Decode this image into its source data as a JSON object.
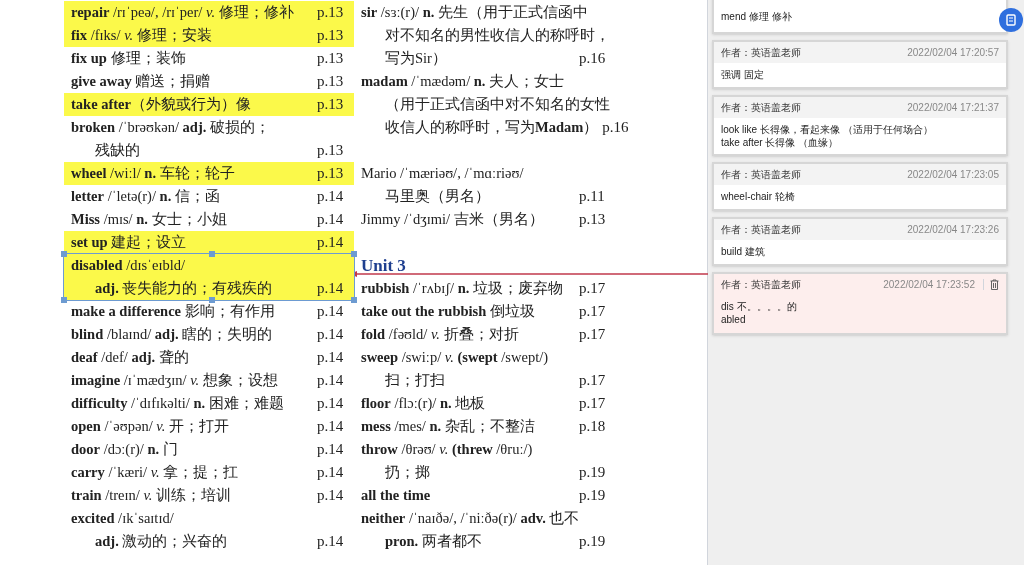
{
  "document": {
    "columns": [
      {
        "sections": [
          {
            "entries": [
              {
                "highlighted": true,
                "selected": false,
                "lines": [
                  {
                    "text": "**repair** /rɪˈpeə/, /rɪˈper/ *v.* 修理；修补",
                    "page": "p.13"
                  }
                ]
              },
              {
                "highlighted": true,
                "selected": false,
                "lines": [
                  {
                    "text": "**fix** /fɪks/ *v.* 修理；安装",
                    "page": "p.13"
                  }
                ]
              },
              {
                "highlighted": false,
                "selected": false,
                "lines": [
                  {
                    "text": "**fix up** 修理；装饰",
                    "page": "p.13"
                  }
                ]
              },
              {
                "highlighted": false,
                "selected": false,
                "lines": [
                  {
                    "text": "**give away** 赠送；捐赠",
                    "page": "p.13"
                  }
                ]
              },
              {
                "highlighted": true,
                "selected": false,
                "lines": [
                  {
                    "text": "**take after**（外貌或行为）像",
                    "page": "p.13"
                  }
                ]
              },
              {
                "highlighted": false,
                "selected": false,
                "lines": [
                  {
                    "text": "**broken** /ˈbrəʊkən/ **adj.** 破损的；"
                  },
                  {
                    "text": "残缺的",
                    "page": "p.13"
                  }
                ]
              },
              {
                "highlighted": true,
                "selected": false,
                "lines": [
                  {
                    "text": "**wheel** /wiːl/ **n.** 车轮；轮子",
                    "page": "p.13"
                  }
                ]
              },
              {
                "highlighted": false,
                "selected": false,
                "lines": [
                  {
                    "text": "**letter** /ˈletə(r)/ **n.** 信；函",
                    "page": "p.14"
                  }
                ]
              },
              {
                "highlighted": false,
                "selected": false,
                "lines": [
                  {
                    "text": "**Miss** /mɪs/ **n.** 女士；小姐",
                    "page": "p.14"
                  }
                ]
              },
              {
                "highlighted": true,
                "selected": false,
                "lines": [
                  {
                    "text": "**set up** 建起；设立",
                    "page": "p.14"
                  }
                ]
              },
              {
                "highlighted": true,
                "selected": true,
                "lines": [
                  {
                    "text": "**disabled** /dɪsˈeɪbld/"
                  },
                  {
                    "text": "**adj.** 丧失能力的；有残疾的",
                    "page": "p.14"
                  }
                ]
              },
              {
                "highlighted": false,
                "selected": false,
                "lines": [
                  {
                    "text": "**make a difference** 影响；有作用",
                    "page": "p.14"
                  }
                ]
              },
              {
                "highlighted": false,
                "selected": false,
                "lines": [
                  {
                    "text": "**blind** /blaɪnd/ **adj.** 瞎的；失明的",
                    "page": "p.14"
                  }
                ]
              },
              {
                "highlighted": false,
                "selected": false,
                "lines": [
                  {
                    "text": "**deaf** /def/ **adj.** 聋的",
                    "page": "p.14"
                  }
                ]
              },
              {
                "highlighted": false,
                "selected": false,
                "lines": [
                  {
                    "text": "**imagine** /ɪˈmædʒɪn/ *v.* 想象；设想",
                    "page": "p.14"
                  }
                ]
              },
              {
                "highlighted": false,
                "selected": false,
                "lines": [
                  {
                    "text": "**difficulty** /ˈdɪfɪkəlti/ **n.** 困难；难题",
                    "page": "p.14"
                  }
                ]
              },
              {
                "highlighted": false,
                "selected": false,
                "lines": [
                  {
                    "text": "**open** /ˈəʊpən/ *v.* 开；打开",
                    "page": "p.14"
                  }
                ]
              },
              {
                "highlighted": false,
                "selected": false,
                "lines": [
                  {
                    "text": "**door** /dɔː(r)/ **n.** 门",
                    "page": "p.14"
                  }
                ]
              },
              {
                "highlighted": false,
                "selected": false,
                "lines": [
                  {
                    "text": "**carry** /ˈkæri/ *v.* 拿；提；扛",
                    "page": "p.14"
                  }
                ]
              },
              {
                "highlighted": false,
                "selected": false,
                "lines": [
                  {
                    "text": "**train** /treɪn/ *v.* 训练；培训",
                    "page": "p.14"
                  }
                ]
              },
              {
                "highlighted": false,
                "selected": false,
                "lines": [
                  {
                    "text": "**excited** /ɪkˈsaɪtɪd/"
                  },
                  {
                    "text": "**adj.** 激动的；兴奋的",
                    "page": "p.14"
                  }
                ]
              }
            ]
          }
        ]
      },
      {
        "sections": [
          {
            "entries": [
              {
                "highlighted": false,
                "selected": false,
                "lines": [
                  {
                    "text": "**sir** /sɜː(r)/ **n.** 先生（用于正式信函中"
                  },
                  {
                    "text": "对不知名的男性收信人的称呼时，"
                  },
                  {
                    "text": "写为Sir）",
                    "page": "p.16"
                  }
                ]
              },
              {
                "highlighted": false,
                "selected": false,
                "lines": [
                  {
                    "text": "**madam** /ˈmædəm/ **n.** 夫人；女士"
                  },
                  {
                    "text": "（用于正式信函中对不知名的女性"
                  },
                  {
                    "text": "收信人的称呼时，写为**Madam**）",
                    "page": "p.16"
                  }
                ]
              }
            ]
          },
          {
            "entries": [
              {
                "highlighted": false,
                "selected": false,
                "lines": [
                  {
                    "text": "Mario /ˈmæriəʊ/, /ˈmɑːriəʊ/"
                  },
                  {
                    "text": "马里奥（男名）",
                    "page": "p.11"
                  }
                ]
              },
              {
                "highlighted": false,
                "selected": false,
                "lines": [
                  {
                    "text": "Jimmy /ˈdʒɪmi/ 吉米（男名）",
                    "page": "p.13"
                  }
                ]
              }
            ]
          },
          {
            "heading": "Unit 3",
            "entries": [
              {
                "highlighted": false,
                "selected": false,
                "lines": [
                  {
                    "text": "**rubbish** /ˈrʌbɪʃ/ **n.** 垃圾；废弃物",
                    "page": "p.17"
                  }
                ]
              },
              {
                "highlighted": false,
                "selected": false,
                "lines": [
                  {
                    "text": "**take out the rubbish** 倒垃圾",
                    "page": "p.17"
                  }
                ]
              },
              {
                "highlighted": false,
                "selected": false,
                "lines": [
                  {
                    "text": "**fold** /fəʊld/ *v.* 折叠；对折",
                    "page": "p.17"
                  }
                ]
              },
              {
                "highlighted": false,
                "selected": false,
                "lines": [
                  {
                    "text": "**sweep** /swiːp/ *v.* **(swept** /swept/)"
                  },
                  {
                    "text": "扫；打扫",
                    "page": "p.17"
                  }
                ]
              },
              {
                "highlighted": false,
                "selected": false,
                "lines": [
                  {
                    "text": "**floor** /flɔː(r)/ **n.** 地板",
                    "page": "p.17"
                  }
                ]
              },
              {
                "highlighted": false,
                "selected": false,
                "lines": [
                  {
                    "text": "**mess** /mes/ **n.** 杂乱；不整洁",
                    "page": "p.18"
                  }
                ]
              },
              {
                "highlighted": false,
                "selected": false,
                "lines": [
                  {
                    "text": "**throw** /θrəʊ/ *v.* **(threw** /θruː/)"
                  },
                  {
                    "text": "扔；掷",
                    "page": "p.19"
                  }
                ]
              },
              {
                "highlighted": false,
                "selected": false,
                "lines": [
                  {
                    "text": "**all the time**",
                    "page": "p.19"
                  }
                ]
              },
              {
                "highlighted": false,
                "selected": false,
                "lines": [
                  {
                    "text": "**neither** /ˈnaɪðə/, /ˈniːðə(r)/ **adv.** 也不"
                  },
                  {
                    "text": "**pron.** 两者都不",
                    "page": "p.19"
                  }
                ]
              }
            ]
          }
        ]
      }
    ]
  },
  "comments": [
    {
      "body": "mend  修理  修补",
      "selected": false
    },
    {
      "author": "作者：英语盖老师",
      "time": "2022/02/04 17:20:57",
      "body": "强调 固定",
      "selected": false
    },
    {
      "author": "作者：英语盖老师",
      "time": "2022/02/04 17:21:37",
      "body": "look   like  长得像，看起来像  （适用于任何场合）\ntake after   长得像   （血缘）",
      "selected": false
    },
    {
      "author": "作者：英语盖老师",
      "time": "2022/02/04 17:23:05",
      "body": "wheel-chair  轮椅",
      "selected": false
    },
    {
      "author": "作者：英语盖老师",
      "time": "2022/02/04 17:23:26",
      "body": "build  建筑",
      "selected": false
    },
    {
      "author": "作者：英语盖老师",
      "time": "2022/02/04 17:23:52",
      "body": "dis  不。。。。的\nabled",
      "selected": true
    }
  ]
}
